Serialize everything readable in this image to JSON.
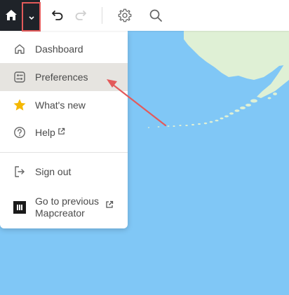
{
  "toolbar": {
    "home_icon": "home-icon",
    "chevron_icon": "chevron-down-icon",
    "undo_icon": "undo-icon",
    "redo_icon": "redo-icon",
    "settings_icon": "gear-icon",
    "search_icon": "search-icon"
  },
  "menu": {
    "items": [
      {
        "label": "Dashboard",
        "icon": "home-outline-icon"
      },
      {
        "label": "Preferences",
        "icon": "preferences-icon",
        "highlighted": true
      },
      {
        "label": "What's new",
        "icon": "star-icon"
      },
      {
        "label": "Help",
        "icon": "help-icon",
        "external": true
      },
      {
        "label": "Sign out",
        "icon": "sign-out-icon"
      },
      {
        "label": "Go to previous Mapcreator",
        "icon": "mapcreator-logo-icon",
        "external": true
      }
    ]
  },
  "colors": {
    "toolbar_dark": "#1f2329",
    "map_water": "#80c7f6",
    "map_land": "#dff0d5",
    "annotation_red": "#e35a5a",
    "star": "#f5b800",
    "highlight_bg": "#e6e4e0"
  }
}
